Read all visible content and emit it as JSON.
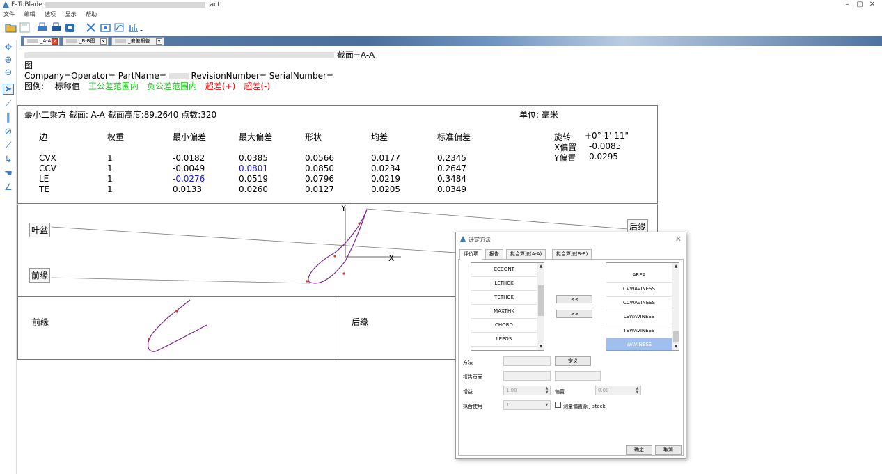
{
  "window": {
    "app_name": "FaToBlade",
    "title_suffix": ".act",
    "minimize": "–",
    "maximize": "▢",
    "close": "✕"
  },
  "menu": [
    "文件",
    "编辑",
    "选项",
    "显示",
    "帮助"
  ],
  "tabs": [
    {
      "label": "_A-A图",
      "active": true
    },
    {
      "label": "_B-B图",
      "active": false
    },
    {
      "label": "_偏差报告",
      "active": false
    }
  ],
  "header": {
    "line1_suffix": "截面=A-A",
    "line2": "图",
    "line3a": "Company=Operator= PartName=",
    "line3b": "RevisionNumber= SerialNumber=",
    "legend_label": "图例:",
    "legend": [
      {
        "text": "标称值",
        "color": "#000000"
      },
      {
        "text": "正公差范围内",
        "color": "#22cc22"
      },
      {
        "text": "负公差范围内",
        "color": "#22cc22"
      },
      {
        "text": "超差(+)",
        "color": "#ee1111"
      },
      {
        "text": "超差(-)",
        "color": "#ee1111"
      }
    ]
  },
  "stats": {
    "summary": "最小二乘方 截面: A-A 截面高度:89.2640 点数:320",
    "unit": "单位: 毫米",
    "columns": [
      "边",
      "权重",
      "最小偏差",
      "最大偏差",
      "形状",
      "均差",
      "标准偏差"
    ],
    "rows": [
      [
        "CVX",
        "1",
        "-0.0182",
        "0.0385",
        "0.0566",
        "0.0177",
        "0.2345"
      ],
      [
        "CCV",
        "1",
        "-0.0049",
        "0.0801",
        "0.0850",
        "0.0234",
        "0.2647"
      ],
      [
        "LE",
        "1",
        "-0.0276",
        "0.0519",
        "0.0796",
        "0.0219",
        "0.3484"
      ],
      [
        "TE",
        "1",
        "0.0133",
        "0.0260",
        "0.0127",
        "0.0205",
        "0.0349"
      ]
    ],
    "highlight": {
      "CCV_max": "#1a1acc",
      "LE_min": "#1a1acc"
    },
    "transform": [
      {
        "label": "旋转",
        "value": "+0° 1' 11\""
      },
      {
        "label": "X偏置",
        "value": "-0.0085"
      },
      {
        "label": "Y偏置",
        "value": "0.0295"
      }
    ]
  },
  "plot": {
    "axis_y": "Y",
    "axis_x": "X",
    "label_pressure": "叶盆",
    "label_leading": "前缘",
    "label_trailing": "后缘",
    "detail_leading": "前缘",
    "detail_trailing": "后缘",
    "profile_color": "#7a2a8a",
    "point_color": "#dd3333"
  },
  "dialog": {
    "title": "评定方法",
    "close": "✕",
    "tabs": [
      "评价项",
      "报告",
      "拟合算法(A-A)",
      "拟合算法(B-B)"
    ],
    "left_list": [
      "CCCONT",
      "LETHCK",
      "TETHCK",
      "MAXTHK",
      "CHORD",
      "LEPOS"
    ],
    "right_list": [
      "AREA",
      "CVWAVINESS",
      "CCWAVINESS",
      "LEWAVINESS",
      "TEWAVINESS",
      "WAVINESS"
    ],
    "btn_left": "<<",
    "btn_right": ">>",
    "method_label": "方法",
    "define_btn": "定义",
    "report_page_label": "报告页面",
    "gain_label": "增益",
    "gain_value": "1.00",
    "offset_label": "偏置",
    "offset_value": "0.00",
    "fit_label": "拟合使用",
    "fit_value": "1",
    "checkbox_label": "测量偏置源于stack",
    "ok": "确定",
    "cancel": "取消"
  }
}
